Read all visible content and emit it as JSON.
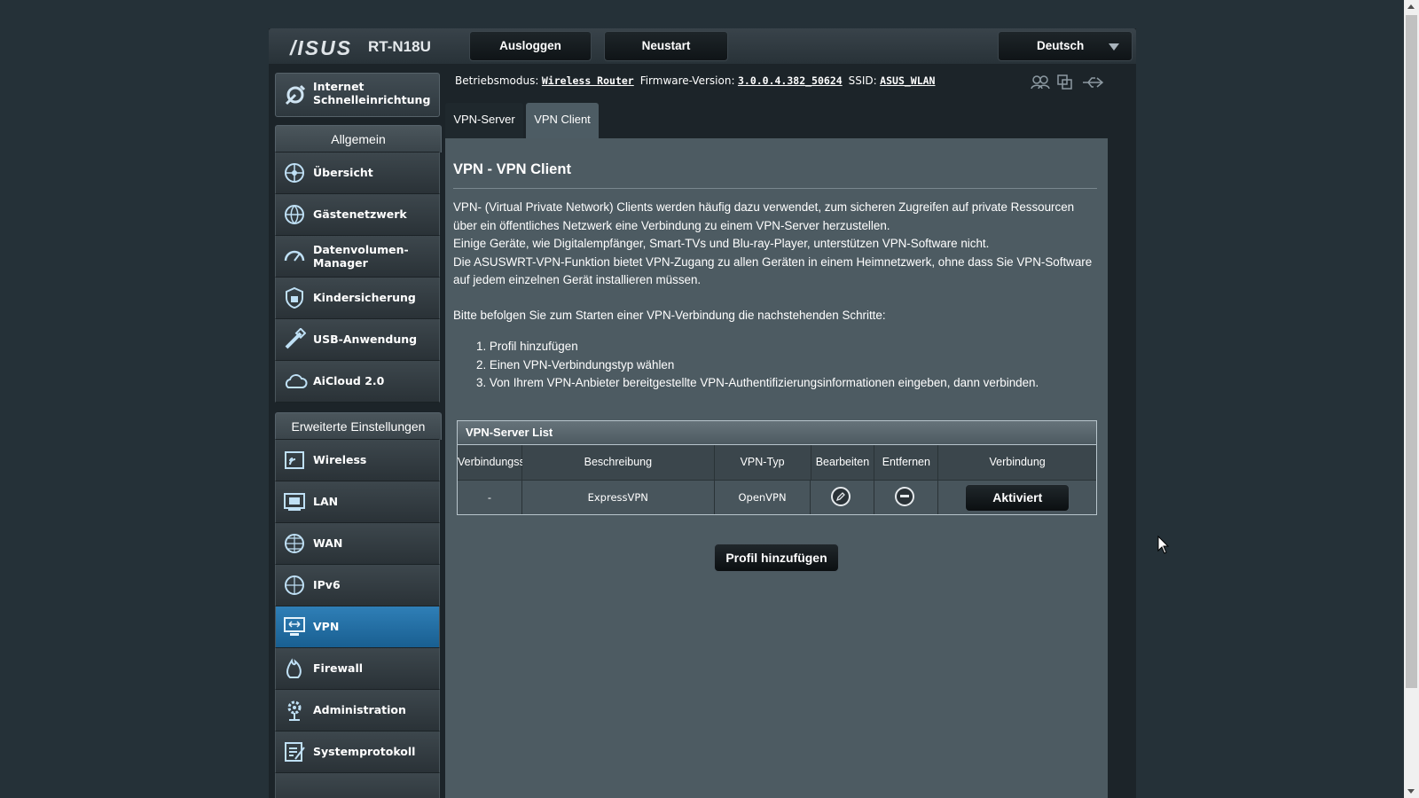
{
  "header": {
    "logo": "/ISUS",
    "model": "RT-N18U",
    "logout_label": "Ausloggen",
    "reboot_label": "Neustart",
    "language": "Deutsch"
  },
  "sidebar": {
    "quick_setup": {
      "line1": "Internet",
      "line2": "Schnelleinrichtung"
    },
    "general_title": "Allgemein",
    "general_items": [
      {
        "label": "Übersicht",
        "icon": "network-map-icon"
      },
      {
        "label": "Gästenetzwerk",
        "icon": "guest-network-icon"
      },
      {
        "label1": "Datenvolumen-",
        "label2": "Manager",
        "icon": "traffic-gauge-icon"
      },
      {
        "label": "Kindersicherung",
        "icon": "lock-icon"
      },
      {
        "label": "USB-Anwendung",
        "icon": "usb-icon"
      },
      {
        "label": "AiCloud 2.0",
        "icon": "cloud-icon"
      }
    ],
    "advanced_title": "Erweiterte Einstellungen",
    "advanced_items": [
      {
        "label": "Wireless",
        "icon": "wireless-icon"
      },
      {
        "label": "LAN",
        "icon": "lan-icon"
      },
      {
        "label": "WAN",
        "icon": "globe-icon"
      },
      {
        "label": "IPv6",
        "icon": "ipv6-globe-icon"
      },
      {
        "label": "VPN",
        "icon": "vpn-monitor-icon",
        "active": true
      },
      {
        "label": "Firewall",
        "icon": "firewall-icon"
      },
      {
        "label": "Administration",
        "icon": "admin-gear-icon"
      },
      {
        "label": "Systemprotokoll",
        "icon": "log-icon"
      }
    ]
  },
  "status_bar": {
    "mode_key": "Betriebsmodus:",
    "mode_value": "Wireless Router",
    "fw_key": "Firmware-Version:",
    "fw_value": "3.0.0.4.382_50624",
    "ssid_key": "SSID:",
    "ssid_value": "ASUS_WLAN"
  },
  "tabs": [
    "VPN-Server",
    "VPN Client"
  ],
  "main": {
    "title": "VPN - VPN Client",
    "description_lines": [
      "VPN- (Virtual Private Network) Clients werden häufig dazu verwendet, zum sicheren Zugreifen auf private Ressourcen über ein öffentliches Netzwerk eine Verbindung zu einem VPN-Server herzustellen.",
      "Einige Geräte, wie Digitalempfänger, Smart-TVs und Blu-ray-Player, unterstützen VPN-Software nicht.",
      "Die ASUSWRT-VPN-Funktion bietet VPN-Zugang zu allen Geräten in einem Heimnetzwerk, ohne dass Sie VPN-Software auf jedem einzelnen Gerät installieren müssen."
    ],
    "instructions": "Bitte befolgen Sie zum Starten einer VPN-Verbindung die nachstehenden Schritte:",
    "steps": [
      "1. Profil hinzufügen",
      "2. Einen VPN-Verbindungstyp wählen",
      "3. Von Ihrem VPN-Anbieter bereitgestellte VPN-Authentifizierungsinformationen eingeben, dann verbinden."
    ],
    "table": {
      "title": "VPN-Server List",
      "columns": [
        "Verbindungsstatus",
        "Beschreibung",
        "VPN-Typ",
        "Bearbeiten",
        "Entfernen",
        "Verbindung"
      ],
      "rows": [
        {
          "status": "-",
          "description": "ExpressVPN",
          "type": "OpenVPN",
          "edit_icon": "edit-pencil-icon",
          "remove_icon": "remove-minus-icon",
          "action": "Aktiviert"
        }
      ]
    },
    "add_profile_label": "Profil hinzufügen"
  },
  "colors": {
    "background": "#253138",
    "panel": "#4d5b62",
    "active_menu": "#2f7fb7"
  }
}
